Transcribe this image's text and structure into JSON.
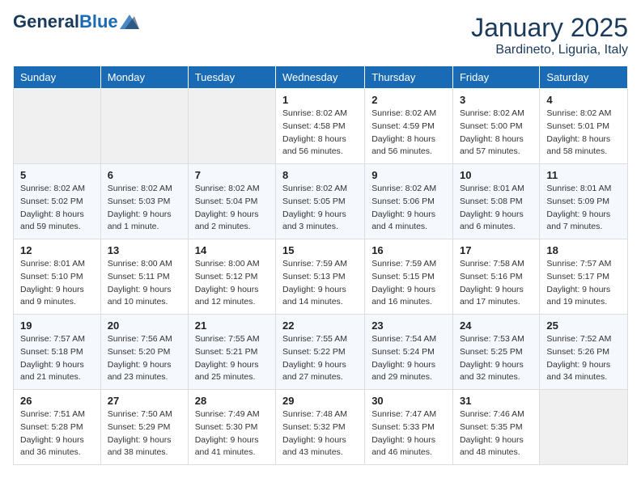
{
  "header": {
    "logo_general": "General",
    "logo_blue": "Blue",
    "month": "January 2025",
    "location": "Bardineto, Liguria, Italy"
  },
  "weekdays": [
    "Sunday",
    "Monday",
    "Tuesday",
    "Wednesday",
    "Thursday",
    "Friday",
    "Saturday"
  ],
  "weeks": [
    [
      {
        "day": "",
        "info": ""
      },
      {
        "day": "",
        "info": ""
      },
      {
        "day": "",
        "info": ""
      },
      {
        "day": "1",
        "info": "Sunrise: 8:02 AM\nSunset: 4:58 PM\nDaylight: 8 hours\nand 56 minutes."
      },
      {
        "day": "2",
        "info": "Sunrise: 8:02 AM\nSunset: 4:59 PM\nDaylight: 8 hours\nand 56 minutes."
      },
      {
        "day": "3",
        "info": "Sunrise: 8:02 AM\nSunset: 5:00 PM\nDaylight: 8 hours\nand 57 minutes."
      },
      {
        "day": "4",
        "info": "Sunrise: 8:02 AM\nSunset: 5:01 PM\nDaylight: 8 hours\nand 58 minutes."
      }
    ],
    [
      {
        "day": "5",
        "info": "Sunrise: 8:02 AM\nSunset: 5:02 PM\nDaylight: 8 hours\nand 59 minutes."
      },
      {
        "day": "6",
        "info": "Sunrise: 8:02 AM\nSunset: 5:03 PM\nDaylight: 9 hours\nand 1 minute."
      },
      {
        "day": "7",
        "info": "Sunrise: 8:02 AM\nSunset: 5:04 PM\nDaylight: 9 hours\nand 2 minutes."
      },
      {
        "day": "8",
        "info": "Sunrise: 8:02 AM\nSunset: 5:05 PM\nDaylight: 9 hours\nand 3 minutes."
      },
      {
        "day": "9",
        "info": "Sunrise: 8:02 AM\nSunset: 5:06 PM\nDaylight: 9 hours\nand 4 minutes."
      },
      {
        "day": "10",
        "info": "Sunrise: 8:01 AM\nSunset: 5:08 PM\nDaylight: 9 hours\nand 6 minutes."
      },
      {
        "day": "11",
        "info": "Sunrise: 8:01 AM\nSunset: 5:09 PM\nDaylight: 9 hours\nand 7 minutes."
      }
    ],
    [
      {
        "day": "12",
        "info": "Sunrise: 8:01 AM\nSunset: 5:10 PM\nDaylight: 9 hours\nand 9 minutes."
      },
      {
        "day": "13",
        "info": "Sunrise: 8:00 AM\nSunset: 5:11 PM\nDaylight: 9 hours\nand 10 minutes."
      },
      {
        "day": "14",
        "info": "Sunrise: 8:00 AM\nSunset: 5:12 PM\nDaylight: 9 hours\nand 12 minutes."
      },
      {
        "day": "15",
        "info": "Sunrise: 7:59 AM\nSunset: 5:13 PM\nDaylight: 9 hours\nand 14 minutes."
      },
      {
        "day": "16",
        "info": "Sunrise: 7:59 AM\nSunset: 5:15 PM\nDaylight: 9 hours\nand 16 minutes."
      },
      {
        "day": "17",
        "info": "Sunrise: 7:58 AM\nSunset: 5:16 PM\nDaylight: 9 hours\nand 17 minutes."
      },
      {
        "day": "18",
        "info": "Sunrise: 7:57 AM\nSunset: 5:17 PM\nDaylight: 9 hours\nand 19 minutes."
      }
    ],
    [
      {
        "day": "19",
        "info": "Sunrise: 7:57 AM\nSunset: 5:18 PM\nDaylight: 9 hours\nand 21 minutes."
      },
      {
        "day": "20",
        "info": "Sunrise: 7:56 AM\nSunset: 5:20 PM\nDaylight: 9 hours\nand 23 minutes."
      },
      {
        "day": "21",
        "info": "Sunrise: 7:55 AM\nSunset: 5:21 PM\nDaylight: 9 hours\nand 25 minutes."
      },
      {
        "day": "22",
        "info": "Sunrise: 7:55 AM\nSunset: 5:22 PM\nDaylight: 9 hours\nand 27 minutes."
      },
      {
        "day": "23",
        "info": "Sunrise: 7:54 AM\nSunset: 5:24 PM\nDaylight: 9 hours\nand 29 minutes."
      },
      {
        "day": "24",
        "info": "Sunrise: 7:53 AM\nSunset: 5:25 PM\nDaylight: 9 hours\nand 32 minutes."
      },
      {
        "day": "25",
        "info": "Sunrise: 7:52 AM\nSunset: 5:26 PM\nDaylight: 9 hours\nand 34 minutes."
      }
    ],
    [
      {
        "day": "26",
        "info": "Sunrise: 7:51 AM\nSunset: 5:28 PM\nDaylight: 9 hours\nand 36 minutes."
      },
      {
        "day": "27",
        "info": "Sunrise: 7:50 AM\nSunset: 5:29 PM\nDaylight: 9 hours\nand 38 minutes."
      },
      {
        "day": "28",
        "info": "Sunrise: 7:49 AM\nSunset: 5:30 PM\nDaylight: 9 hours\nand 41 minutes."
      },
      {
        "day": "29",
        "info": "Sunrise: 7:48 AM\nSunset: 5:32 PM\nDaylight: 9 hours\nand 43 minutes."
      },
      {
        "day": "30",
        "info": "Sunrise: 7:47 AM\nSunset: 5:33 PM\nDaylight: 9 hours\nand 46 minutes."
      },
      {
        "day": "31",
        "info": "Sunrise: 7:46 AM\nSunset: 5:35 PM\nDaylight: 9 hours\nand 48 minutes."
      },
      {
        "day": "",
        "info": ""
      }
    ]
  ]
}
